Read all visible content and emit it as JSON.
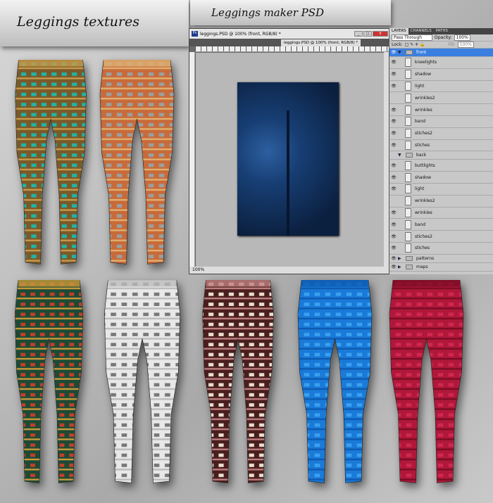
{
  "titles": {
    "textures": "Leggings textures",
    "maker": "Leggings maker PSD"
  },
  "ps": {
    "window_title": "leggings.PSD @ 100% (front, RGB/8) *",
    "tab_title": "leggings.PSD @ 100% (front, RGB/8) *",
    "zoom": "100%",
    "logo": "Ps",
    "min": "_",
    "max": "□",
    "close": "X"
  },
  "layers_panel": {
    "tabs": [
      "LAYERS",
      "CHANNELS",
      "PATHS"
    ],
    "blend_mode": "Pass Through",
    "opacity_label": "Opacity:",
    "opacity": "100%",
    "lock_label": "Lock:",
    "fill_label": "Fill:",
    "fill": "100%",
    "layers": [
      {
        "name": "front",
        "type": "group",
        "open": true,
        "visible": true,
        "selected": true
      },
      {
        "name": "kneelights",
        "visible": true
      },
      {
        "name": "shadow",
        "visible": true
      },
      {
        "name": "light",
        "visible": true
      },
      {
        "name": "wrinkles2",
        "visible": false
      },
      {
        "name": "wrinkles",
        "visible": true
      },
      {
        "name": "band",
        "visible": true
      },
      {
        "name": "stiches2",
        "visible": true
      },
      {
        "name": "stiches",
        "visible": true
      },
      {
        "name": "back",
        "type": "group",
        "open": true,
        "visible": false
      },
      {
        "name": "buttlights",
        "visible": true
      },
      {
        "name": "shadow",
        "visible": true
      },
      {
        "name": "light",
        "visible": true
      },
      {
        "name": "wrinkles2",
        "visible": false
      },
      {
        "name": "wrinkles",
        "visible": true
      },
      {
        "name": "band",
        "visible": true
      },
      {
        "name": "stiches2",
        "visible": true
      },
      {
        "name": "stiches",
        "visible": true
      },
      {
        "name": "patterns",
        "type": "group",
        "open": false,
        "visible": true
      },
      {
        "name": "maps",
        "type": "group",
        "open": false,
        "visible": true
      }
    ]
  },
  "leggings": [
    {
      "name": "aztec-teal",
      "colors": [
        "#7a5a2a",
        "#1fb5a8",
        "#c89a4a"
      ]
    },
    {
      "name": "striped-orange",
      "colors": [
        "#c86a3a",
        "#9aa0a0",
        "#e0b070"
      ]
    },
    {
      "name": "ethnic-green",
      "colors": [
        "#1d4a35",
        "#c0402a",
        "#c89a3a"
      ]
    },
    {
      "name": "lace-white",
      "colors": [
        "#e8e8e8",
        "#777777",
        "#bbbbbb"
      ]
    },
    {
      "name": "brown-squares",
      "colors": [
        "#4a1e1e",
        "#eae0d0",
        "#c08080"
      ]
    },
    {
      "name": "blue-plaid",
      "colors": [
        "#1a7ad8",
        "#3aa0f0",
        "#0d5ab0"
      ]
    },
    {
      "name": "crimson",
      "colors": [
        "#b0183a",
        "#d02850",
        "#7a0c24"
      ]
    }
  ]
}
